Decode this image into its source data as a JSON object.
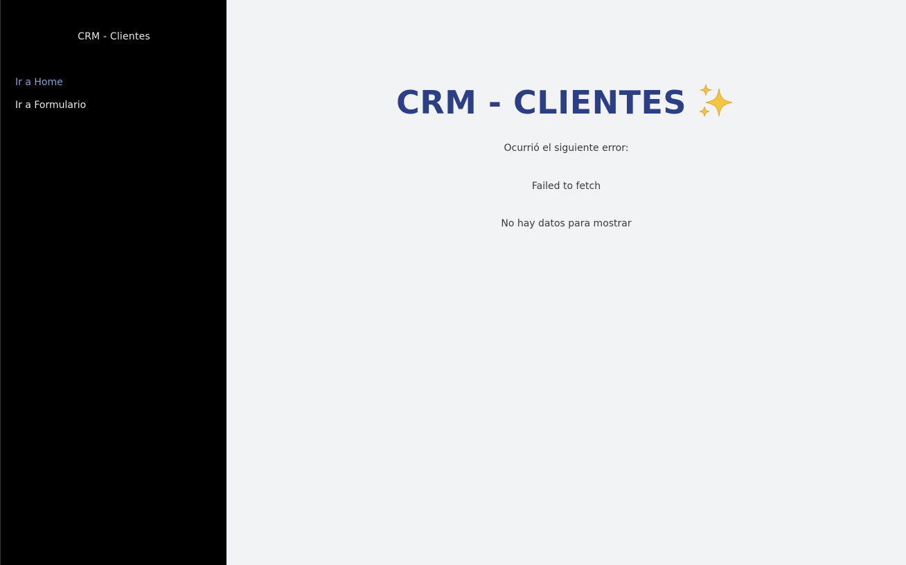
{
  "sidebar": {
    "title": "CRM - Clientes",
    "nav_items": [
      {
        "label": "Ir a Home",
        "active": true
      },
      {
        "label": "Ir a Formulario",
        "active": false
      }
    ]
  },
  "main": {
    "heading": "CRM - CLIENTES",
    "heading_icon": "sparkles-icon",
    "error_intro": "Ocurrió el siguiente error:",
    "error_message": "Failed to fetch",
    "empty_message": "No hay datos para mostrar"
  },
  "colors": {
    "sidebar_bg": "#000000",
    "main_bg": "#f2f3f5",
    "heading": "#2b3f86",
    "active_link": "#7fa3d8",
    "sparkle": "#f5c542"
  }
}
